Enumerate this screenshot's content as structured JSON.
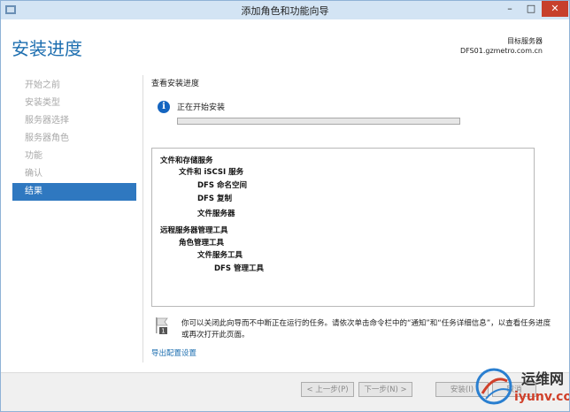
{
  "window": {
    "title": "添加角色和功能向导",
    "min_label": "–",
    "max_label": "□",
    "close_label": "✕"
  },
  "header": {
    "page_title": "安装进度",
    "destination_label": "目标服务器",
    "destination_server": "DFS01.gzmetro.com.cn"
  },
  "sidebar": {
    "items": [
      {
        "label": "开始之前",
        "state": "disabled"
      },
      {
        "label": "安装类型",
        "state": "disabled"
      },
      {
        "label": "服务器选择",
        "state": "disabled"
      },
      {
        "label": "服务器角色",
        "state": "disabled"
      },
      {
        "label": "功能",
        "state": "disabled"
      },
      {
        "label": "确认",
        "state": "disabled"
      },
      {
        "label": "结果",
        "state": "active"
      }
    ]
  },
  "main": {
    "section_title": "查看安装进度",
    "status_icon": "info-icon",
    "status_text": "正在开始安装",
    "progress_fraction": 0.0,
    "results": [
      "文件和存储服务",
      "文件和 iSCSI 服务",
      "DFS 命名空间",
      "DFS 复制",
      "文件服务器",
      "远程服务器管理工具",
      "角色管理工具",
      "文件服务工具",
      "DFS 管理工具"
    ],
    "notice_icon": "flag-icon",
    "notice_text": "你可以关闭此向导而不中断正在运行的任务。请依次单击命令栏中的“通知”和“任务详细信息”，以查看任务进度或再次打开此页面。",
    "export_link": "导出配置设置"
  },
  "footer": {
    "prev": "< 上一步(P)",
    "next": "下一步(N) >",
    "install": "安装(I)",
    "cancel": "取消"
  },
  "watermark": {
    "text1": "运维网",
    "text2": "iyunv.com"
  },
  "colors": {
    "accent": "#2f78c0",
    "title_blue": "#1e6fb0",
    "progress_green": "#06b025",
    "close_red": "#c7402c"
  }
}
